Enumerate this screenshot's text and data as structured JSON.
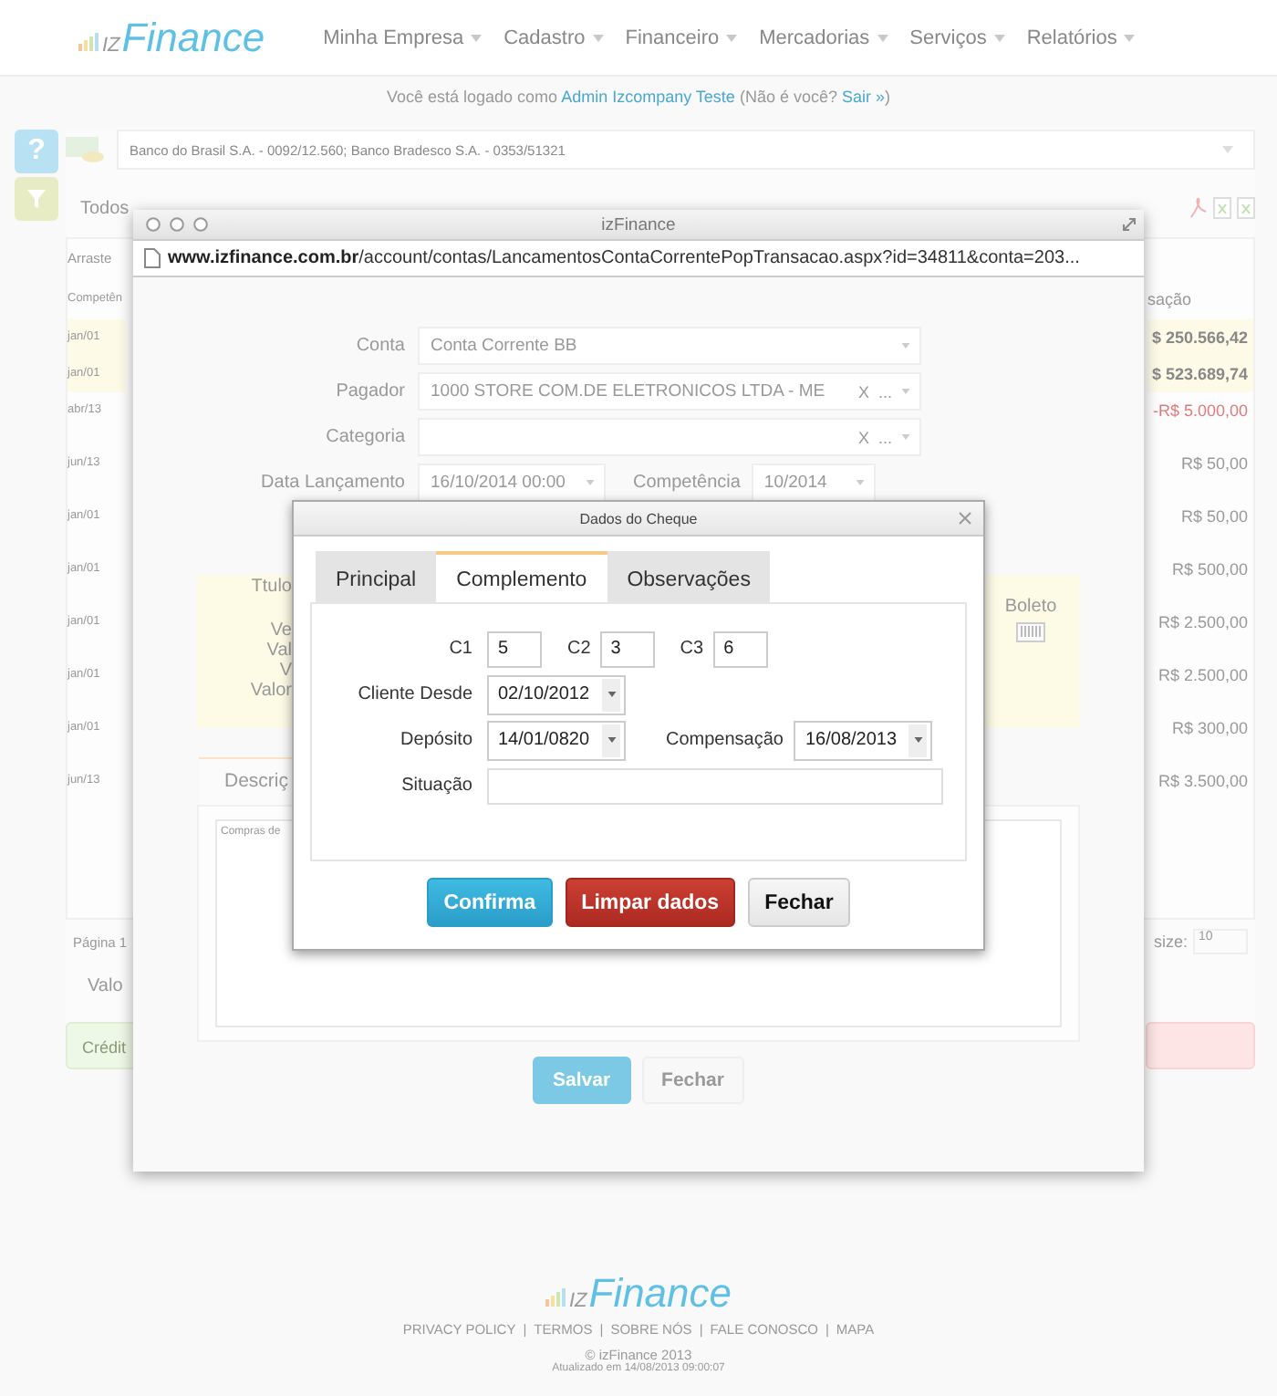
{
  "header": {
    "logo": {
      "mark": "IZ",
      "name": "Finance"
    },
    "nav": [
      "Minha Empresa",
      "Cadastro",
      "Financeiro",
      "Mercadorias",
      "Serviços",
      "Relatórios"
    ]
  },
  "login_notice": {
    "prefix": "Você está logado como",
    "user": "Admin Izcompany Teste",
    "question": "(Não é você?",
    "logout": "Sair »",
    "suffix": ")"
  },
  "help_button": "?",
  "account_select": {
    "value": "Banco do Brasil S.A. - 0092/12.560; Banco Bradesco S.A. - 0353/51321"
  },
  "period_filter": "Todos",
  "grid": {
    "drag_hint": "Arraste",
    "left_header": "Competên",
    "right_header": "sação",
    "rows": [
      {
        "date": "jan/01",
        "amount": "$ 250.566,42",
        "highlight": true,
        "negative": false
      },
      {
        "date": "jan/01",
        "amount": "$ 523.689,74",
        "highlight": true,
        "negative": false
      },
      {
        "date": "abr/13",
        "amount": "-R$ 5.000,00",
        "highlight": false,
        "negative": true
      },
      {
        "date": "jun/13",
        "amount": "R$ 50,00",
        "highlight": false,
        "negative": false
      },
      {
        "date": "jan/01",
        "amount": "R$ 50,00",
        "highlight": false,
        "negative": false
      },
      {
        "date": "jan/01",
        "amount": "R$ 500,00",
        "highlight": false,
        "negative": false
      },
      {
        "date": "jan/01",
        "amount": "R$ 2.500,00",
        "highlight": false,
        "negative": false
      },
      {
        "date": "jan/01",
        "amount": "R$ 2.500,00",
        "highlight": false,
        "negative": false
      },
      {
        "date": "jan/01",
        "amount": "R$ 300,00",
        "highlight": false,
        "negative": false
      },
      {
        "date": "jun/13",
        "amount": "R$ 3.500,00",
        "highlight": false,
        "negative": false
      }
    ],
    "pager": "Página 1",
    "page_size_label": "size:",
    "page_size": "10",
    "total_label": "Valo",
    "credit_label": "Crédit"
  },
  "popup": {
    "title": "izFinance",
    "url": {
      "domain": "www.izfinance.com.br",
      "path": "/account/contas/LancamentosContaCorrentePopTransacao.aspx?id=34811&conta=203..."
    },
    "fields": [
      {
        "label": "Conta",
        "value": "Conta Corrente BB",
        "kind": "select"
      },
      {
        "label": "Pagador",
        "value": "1000 STORE COM.DE ELETRONICOS LTDA - ME",
        "kind": "lookup",
        "clear": "X",
        "more": "..."
      },
      {
        "label": "Categoria",
        "kind": "lookup",
        "clear": "X",
        "more": "..."
      }
    ],
    "date_label": "Data Lançamento",
    "date_value": "16/10/2014 00:00",
    "period_label": "Competência",
    "period_value": "10/2014",
    "summary_labels": [
      "Ttulo",
      "Ve",
      "Val",
      "V",
      "Valor"
    ],
    "boleto": "Boleto",
    "description_tab": "Descriç",
    "description": "Compras de",
    "buttons": [
      {
        "label": "Salvar",
        "kind": "primary"
      },
      {
        "label": "Fechar",
        "kind": "default"
      }
    ]
  },
  "dialog": {
    "title": "Dados do Cheque",
    "tabs": [
      {
        "label": "Principal",
        "selected": false
      },
      {
        "label": "Complemento",
        "selected": true
      },
      {
        "label": "Observações",
        "selected": false
      }
    ],
    "codes": [
      {
        "label": "C1",
        "value": "5"
      },
      {
        "label": "C2",
        "value": "3"
      },
      {
        "label": "C3",
        "value": "6"
      }
    ],
    "client_since": {
      "label": "Cliente Desde",
      "value": "02/10/2012"
    },
    "deposit": {
      "label": "Depósito",
      "value": "14/01/0820"
    },
    "clearing": {
      "label": "Compensação",
      "value": "16/08/2013"
    },
    "status": {
      "label": "Situação"
    },
    "buttons": [
      {
        "label": "Confirma",
        "kind": "primary"
      },
      {
        "label": "Limpar dados",
        "kind": "danger"
      },
      {
        "label": "Fechar",
        "kind": "default"
      }
    ]
  },
  "footer": {
    "logo": {
      "mark": "IZ",
      "name": "Finance"
    },
    "links": [
      "PRIVACY POLICY",
      "TERMOS",
      "SOBRE NÓS",
      "FALE CONOSCO",
      "MAPA"
    ],
    "link_separator": "|",
    "copyright": "© izFinance 2013",
    "updated": "Atualizado em 14/08/2013 09:00:07"
  }
}
